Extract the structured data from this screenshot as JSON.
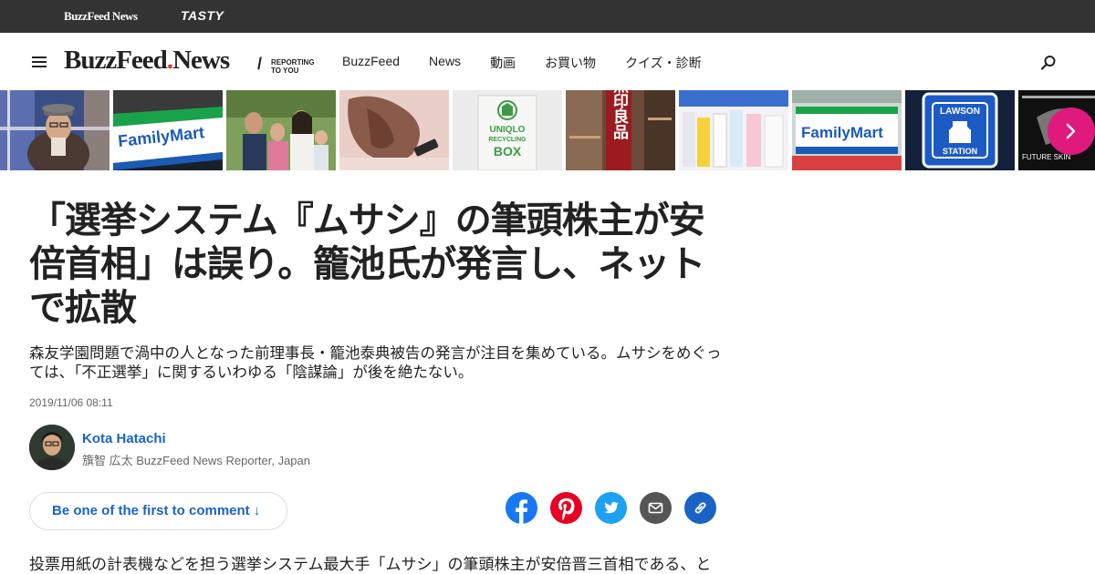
{
  "topbar": {
    "brand_news": "BuzzFeed News",
    "brand_tasty": "TASTY"
  },
  "header": {
    "logo_main": "BuzzFeed",
    "logo_news": "News",
    "tagline_line1": "REPORTING",
    "tagline_line2": "TO YOU",
    "nav": [
      "BuzzFeed",
      "News",
      "動画",
      "お買い物",
      "クイズ・診断"
    ]
  },
  "thumbnails": {
    "familymart_label": "FamilyMart",
    "uniqlo_line1": "UNIQLO",
    "uniqlo_line2": "RECYCLING",
    "uniqlo_line3": "BOX",
    "muji_label": "無印良品",
    "lawson_line1": "LAWSON",
    "lawson_line2": "STATION",
    "future_skin": "FUTURE SKIN"
  },
  "article": {
    "headline": "「選挙システム『ムサシ』の筆頭株主が安倍首相」は誤り。籠池氏が発言し、ネットで拡散",
    "dek": "森友学園問題で渦中の人となった前理事長・籠池泰典被告の発言が注目を集めている。ムサシをめぐっては、「不正選挙」に関するいわゆる「陰謀論」が後を絶たない。",
    "timestamp": "2019/11/06 08:11",
    "author_name": "Kota Hatachi",
    "author_title": "籏智 広太 BuzzFeed News Reporter, Japan",
    "comment_label": "Be one of the first to comment ↓",
    "body_first_line": "投票用紙の計表機などを担う選挙システム最大手「ムサシ」の筆頭株主が安倍晋三首相である、と"
  },
  "colors": {
    "topbar_bg": "#333333",
    "link_blue": "#1a63c6",
    "facebook": "#1877f2",
    "pinterest": "#e60023",
    "twitter": "#1da1f2",
    "email": "#555555",
    "copylink": "#1a63c6",
    "carousel_next": "#e0197d"
  },
  "icons": [
    "menu-icon",
    "search-icon",
    "chevron-right-icon",
    "facebook-icon",
    "pinterest-icon",
    "twitter-icon",
    "email-icon",
    "link-icon"
  ]
}
